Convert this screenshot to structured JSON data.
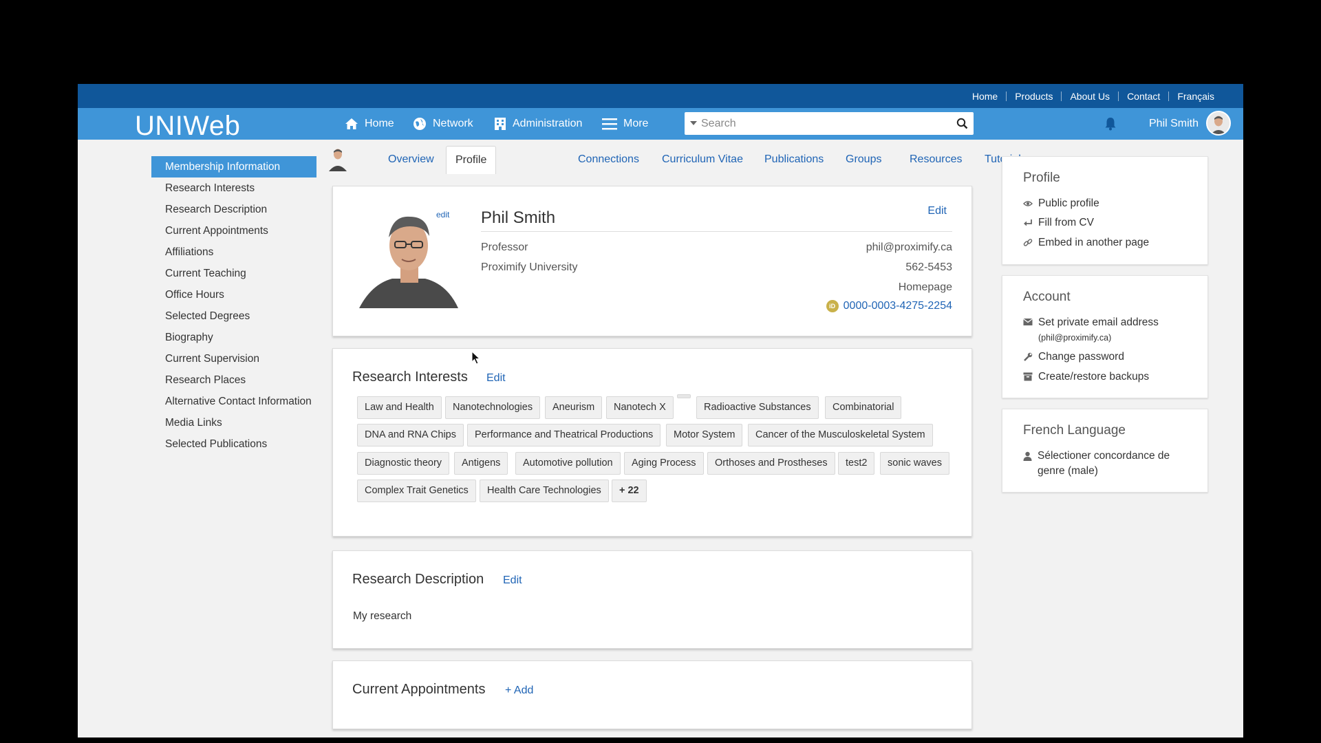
{
  "utility_nav": [
    "Home",
    "Products",
    "About Us",
    "Contact",
    "Français"
  ],
  "header": {
    "logo": "UNIWeb",
    "nav": {
      "home": "Home",
      "network": "Network",
      "administration": "Administration",
      "more": "More"
    },
    "search_placeholder": "Search",
    "user_name": "Phil Smith"
  },
  "sidebar": {
    "items": [
      {
        "label": "Membership Information"
      },
      {
        "label": "Research Interests"
      },
      {
        "label": "Research Description"
      },
      {
        "label": "Current Appointments"
      },
      {
        "label": "Affiliations"
      },
      {
        "label": "Current Teaching"
      },
      {
        "label": "Office Hours"
      },
      {
        "label": "Selected Degrees"
      },
      {
        "label": "Biography"
      },
      {
        "label": "Current Supervision"
      },
      {
        "label": "Research Places"
      },
      {
        "label": "Alternative Contact Information"
      },
      {
        "label": "Media Links"
      },
      {
        "label": "Selected Publications"
      }
    ]
  },
  "tabs": [
    {
      "label": "Overview"
    },
    {
      "label": "Profile"
    },
    {
      "label": "Connections"
    },
    {
      "label": "Curriculum Vitae"
    },
    {
      "label": "Publications"
    },
    {
      "label": "Groups"
    },
    {
      "label": "Resources"
    },
    {
      "label": "Tutorials"
    }
  ],
  "profile": {
    "photo_edit": "edit",
    "name": "Phil Smith",
    "edit": "Edit",
    "title": "Professor",
    "institution": "Proximify University",
    "email": "phil@proximify.ca",
    "phone": "562-5453",
    "homepage": "Homepage",
    "orcid": "0000-0003-4275-2254",
    "orcid_badge": "iD"
  },
  "research_interests": {
    "title": "Research Interests",
    "edit": "Edit",
    "tags": [
      "Law and Health",
      "Nanotechnologies",
      "Aneurism",
      "Nanotech X",
      "Radioactive Substances",
      "Combinatorial",
      "DNA and RNA Chips",
      "Performance and Theatrical Productions",
      "Motor System",
      "Cancer of the Musculoskeletal System",
      "Diagnostic theory",
      "Antigens",
      "Automotive pollution",
      "Aging Process",
      "Orthoses and Prostheses",
      "test2",
      "sonic waves",
      "Complex Trait Genetics",
      "Health Care Technologies"
    ],
    "more": "+ 22"
  },
  "research_description": {
    "title": "Research Description",
    "edit": "Edit",
    "text": "My research"
  },
  "current_appointments": {
    "title": "Current Appointments",
    "add": "+ Add"
  },
  "right_profile": {
    "title": "Profile",
    "items": [
      "Public profile",
      "Fill from CV",
      "Embed in another page"
    ]
  },
  "right_account": {
    "title": "Account",
    "private_email": "Set private email address",
    "private_email_sub": "(phil@proximify.ca)",
    "change_password": "Change password",
    "backups": "Create/restore backups"
  },
  "right_french": {
    "title": "French Language",
    "item": "Sélectioner concordance de genre (male)"
  },
  "colors": {
    "brand_dark": "#10579a",
    "brand": "#3f95d8",
    "link": "#1f64b5"
  }
}
